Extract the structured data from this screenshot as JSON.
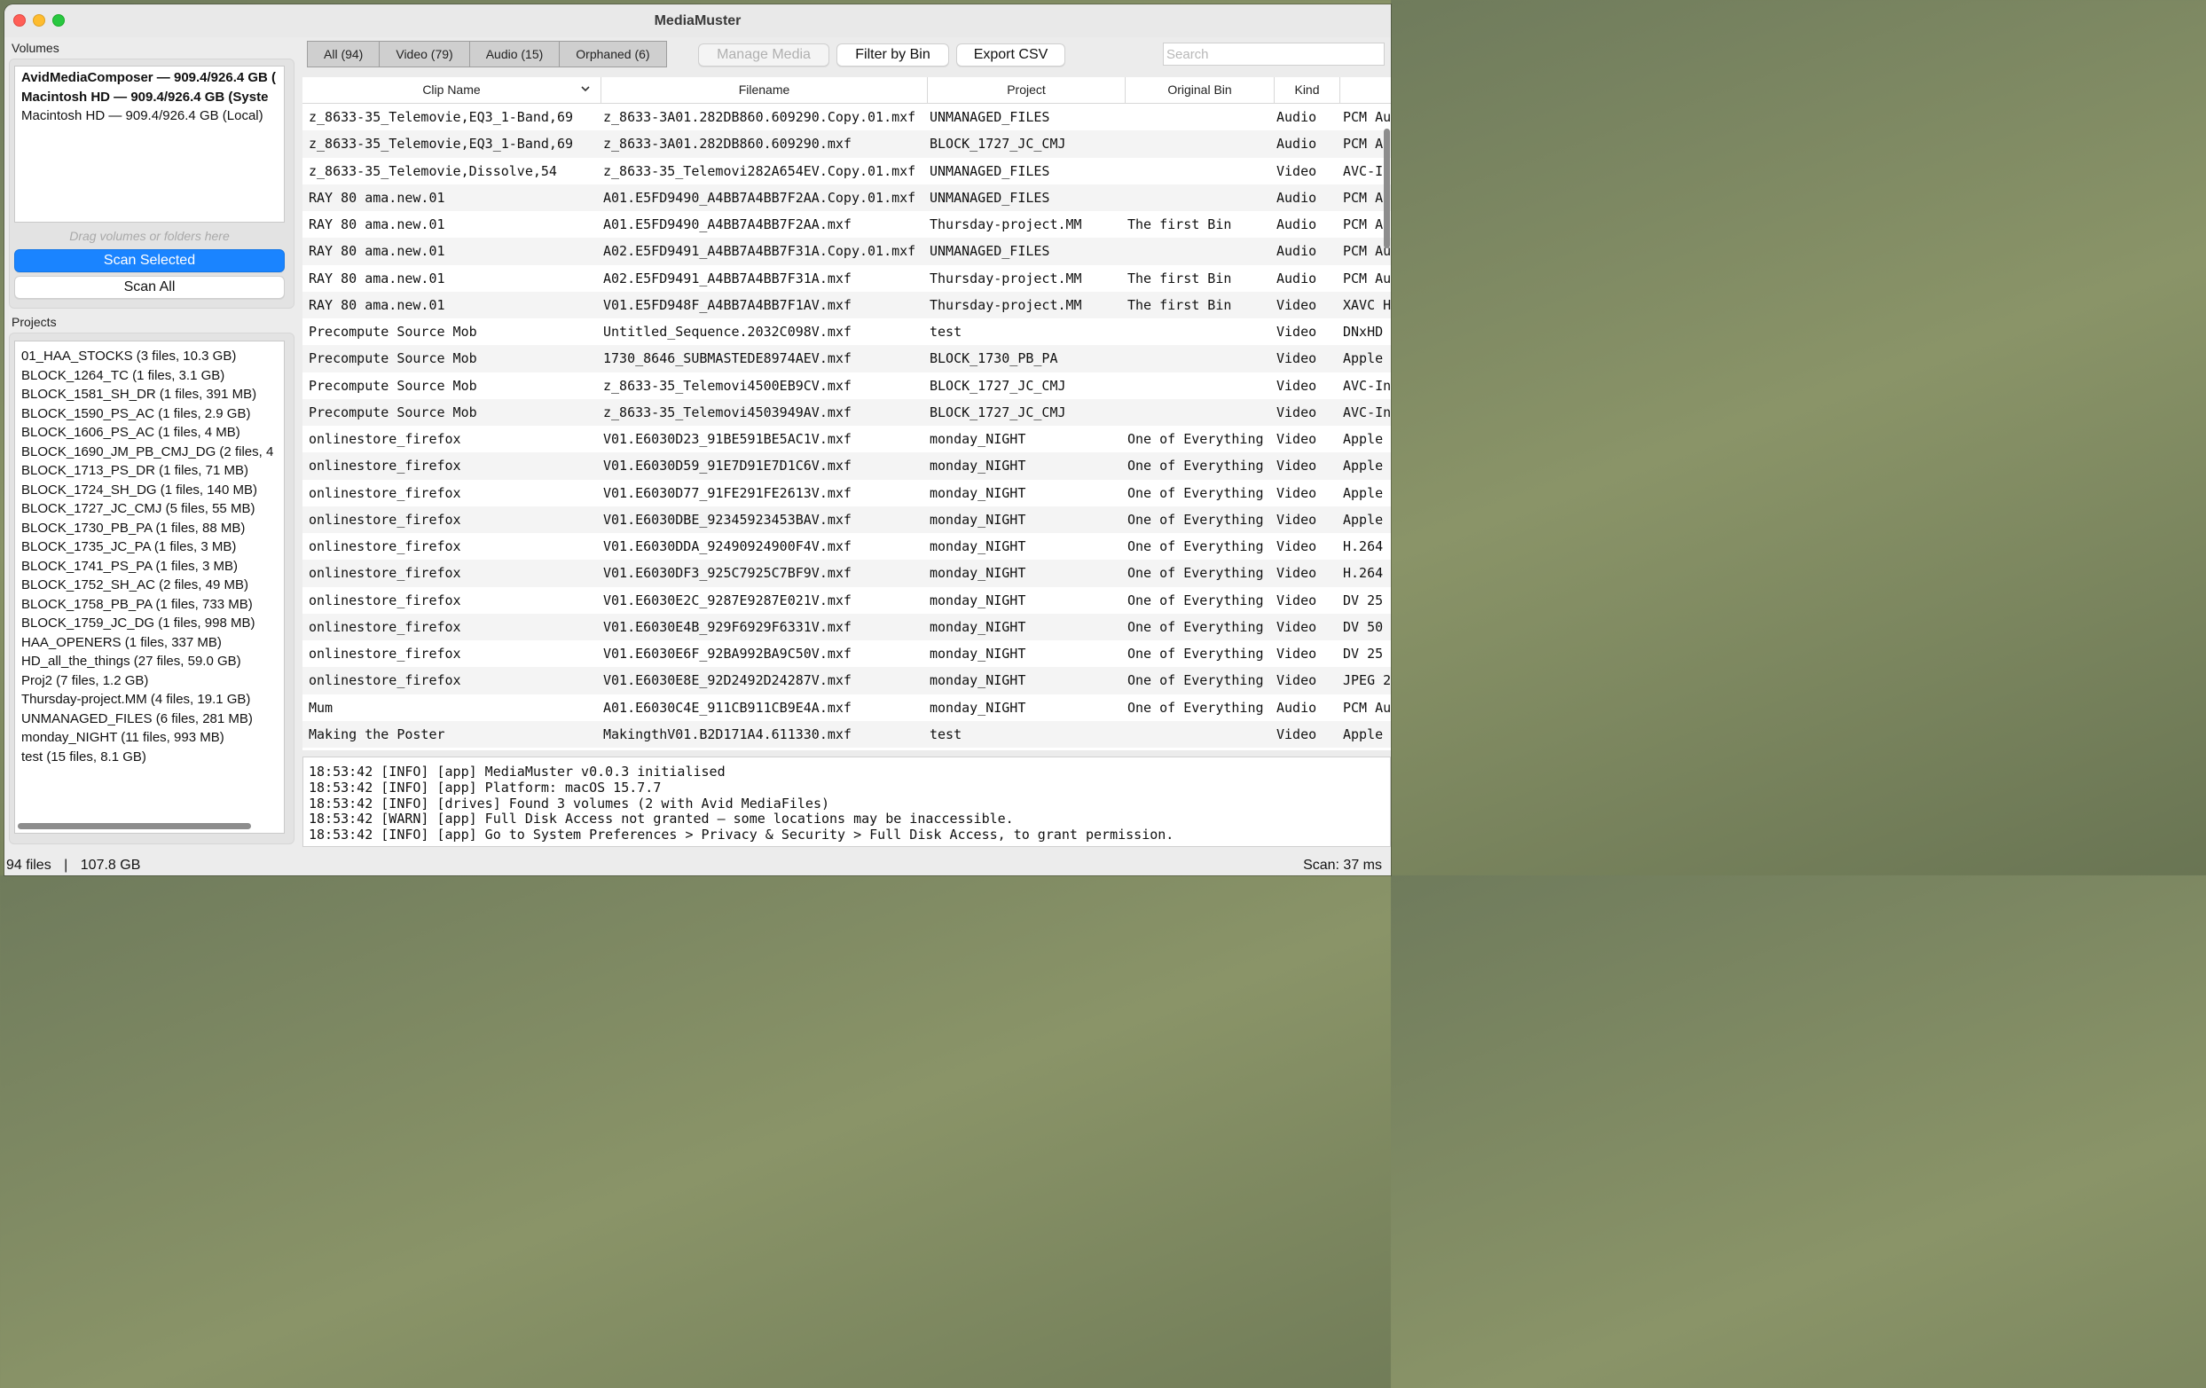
{
  "window": {
    "title": "MediaMuster"
  },
  "volumes": {
    "label": "Volumes",
    "items": [
      {
        "text": "AvidMediaComposer — 909.4/926.4 GB (",
        "bold": true
      },
      {
        "text": "Macintosh HD — 909.4/926.4 GB (Syste",
        "bold": true
      },
      {
        "text": "Macintosh HD — 909.4/926.4 GB (Local)",
        "bold": false
      }
    ],
    "drop_hint": "Drag volumes or folders here",
    "scan_selected": "Scan Selected",
    "scan_all": "Scan All"
  },
  "projects": {
    "label": "Projects",
    "items": [
      "01_HAA_STOCKS (3 files, 10.3 GB)",
      "BLOCK_1264_TC (1 files, 3.1 GB)",
      "BLOCK_1581_SH_DR (1 files, 391 MB)",
      "BLOCK_1590_PS_AC (1 files, 2.9 GB)",
      "BLOCK_1606_PS_AC (1 files, 4 MB)",
      "BLOCK_1690_JM_PB_CMJ_DG (2 files, 4",
      "BLOCK_1713_PS_DR (1 files, 71 MB)",
      "BLOCK_1724_SH_DG (1 files, 140 MB)",
      "BLOCK_1727_JC_CMJ (5 files, 55 MB)",
      "BLOCK_1730_PB_PA (1 files, 88 MB)",
      "BLOCK_1735_JC_PA (1 files, 3 MB)",
      "BLOCK_1741_PS_PA (1 files, 3 MB)",
      "BLOCK_1752_SH_AC (2 files, 49 MB)",
      "BLOCK_1758_PB_PA (1 files, 733 MB)",
      "BLOCK_1759_JC_DG (1 files, 998 MB)",
      "HAA_OPENERS (1 files, 337 MB)",
      "HD_all_the_things (27 files, 59.0 GB)",
      "Proj2 (7 files, 1.2 GB)",
      "Thursday-project.MM (4 files, 19.1 GB)",
      "UNMANAGED_FILES (6 files, 281 MB)",
      "monday_NIGHT (11 files, 993 MB)",
      "test (15 files, 8.1 GB)"
    ]
  },
  "toolbar": {
    "tabs": [
      "All (94)",
      "Video (79)",
      "Audio (15)",
      "Orphaned (6)"
    ],
    "manage_media": "Manage Media",
    "filter_by_bin": "Filter by Bin",
    "export_csv": "Export CSV",
    "search_placeholder": "Search"
  },
  "table": {
    "columns": [
      "Clip Name",
      "Filename",
      "Project",
      "Original Bin",
      "Kind",
      ""
    ],
    "rows": [
      [
        "z_8633-35_Telemovie,EQ3_1-Band,69",
        "z_8633-3A01.282DB860.609290.Copy.01.mxf",
        "UNMANAGED_FILES",
        "",
        "Audio",
        "PCM Au"
      ],
      [
        "z_8633-35_Telemovie,EQ3_1-Band,69",
        "z_8633-3A01.282DB860.609290.mxf",
        "BLOCK_1727_JC_CMJ",
        "",
        "Audio",
        "PCM Au"
      ],
      [
        "z_8633-35_Telemovie,Dissolve,54",
        "z_8633-35_Telemovi282A654EV.Copy.01.mxf",
        "UNMANAGED_FILES",
        "",
        "Video",
        "AVC-In"
      ],
      [
        "RAY 80 ama.new.01",
        "A01.E5FD9490_A4BB7A4BB7F2AA.Copy.01.mxf",
        "UNMANAGED_FILES",
        "",
        "Audio",
        "PCM Au"
      ],
      [
        "RAY 80 ama.new.01",
        "A01.E5FD9490_A4BB7A4BB7F2AA.mxf",
        "Thursday-project.MM",
        "The first Bin",
        "Audio",
        "PCM Au"
      ],
      [
        "RAY 80 ama.new.01",
        "A02.E5FD9491_A4BB7A4BB7F31A.Copy.01.mxf",
        "UNMANAGED_FILES",
        "",
        "Audio",
        "PCM Au"
      ],
      [
        "RAY 80 ama.new.01",
        "A02.E5FD9491_A4BB7A4BB7F31A.mxf",
        "Thursday-project.MM",
        "The first Bin",
        "Audio",
        "PCM Au"
      ],
      [
        "RAY 80 ama.new.01",
        "V01.E5FD948F_A4BB7A4BB7F1AV.mxf",
        "Thursday-project.MM",
        "The first Bin",
        "Video",
        "XAVC H"
      ],
      [
        "Precompute Source Mob",
        "Untitled_Sequence.2032C098V.mxf",
        "test",
        "",
        "Video",
        "DNxHD"
      ],
      [
        "Precompute Source Mob",
        "1730_8646_SUBMASTEDE8974AEV.mxf",
        "BLOCK_1730_PB_PA",
        "",
        "Video",
        "Apple"
      ],
      [
        "Precompute Source Mob",
        "z_8633-35_Telemovi4500EB9CV.mxf",
        "BLOCK_1727_JC_CMJ",
        "",
        "Video",
        "AVC-In"
      ],
      [
        "Precompute Source Mob",
        "z_8633-35_Telemovi4503949AV.mxf",
        "BLOCK_1727_JC_CMJ",
        "",
        "Video",
        "AVC-In"
      ],
      [
        "onlinestore_firefox",
        "V01.E6030D23_91BE591BE5AC1V.mxf",
        "monday_NIGHT",
        "One of Everything",
        "Video",
        "Apple"
      ],
      [
        "onlinestore_firefox",
        "V01.E6030D59_91E7D91E7D1C6V.mxf",
        "monday_NIGHT",
        "One of Everything",
        "Video",
        "Apple"
      ],
      [
        "onlinestore_firefox",
        "V01.E6030D77_91FE291FE2613V.mxf",
        "monday_NIGHT",
        "One of Everything",
        "Video",
        "Apple"
      ],
      [
        "onlinestore_firefox",
        "V01.E6030DBE_92345923453BAV.mxf",
        "monday_NIGHT",
        "One of Everything",
        "Video",
        "Apple"
      ],
      [
        "onlinestore_firefox",
        "V01.E6030DDA_92490924900F4V.mxf",
        "monday_NIGHT",
        "One of Everything",
        "Video",
        "H.264"
      ],
      [
        "onlinestore_firefox",
        "V01.E6030DF3_925C7925C7BF9V.mxf",
        "monday_NIGHT",
        "One of Everything",
        "Video",
        "H.264"
      ],
      [
        "onlinestore_firefox",
        "V01.E6030E2C_9287E9287E021V.mxf",
        "monday_NIGHT",
        "One of Everything",
        "Video",
        "DV 25"
      ],
      [
        "onlinestore_firefox",
        "V01.E6030E4B_929F6929F6331V.mxf",
        "monday_NIGHT",
        "One of Everything",
        "Video",
        "DV 50"
      ],
      [
        "onlinestore_firefox",
        "V01.E6030E6F_92BA992BA9C50V.mxf",
        "monday_NIGHT",
        "One of Everything",
        "Video",
        "DV 25"
      ],
      [
        "onlinestore_firefox",
        "V01.E6030E8E_92D2492D24287V.mxf",
        "monday_NIGHT",
        "One of Everything",
        "Video",
        "JPEG 2"
      ],
      [
        "Mum",
        "A01.E6030C4E_911CB911CB9E4A.mxf",
        "monday_NIGHT",
        "One of Everything",
        "Audio",
        "PCM Au"
      ],
      [
        "Making the Poster",
        "MakingthV01.B2D171A4.611330.mxf",
        "test",
        "",
        "Video",
        "Apple"
      ]
    ]
  },
  "log": [
    "18:53:42 [INFO] [app] MediaMuster v0.0.3 initialised",
    "18:53:42 [INFO] [app] Platform: macOS 15.7.7",
    "18:53:42 [INFO] [drives] Found 3 volumes (2 with Avid MediaFiles)",
    "18:53:42 [WARN] [app] Full Disk Access not granted — some locations may be inaccessible.",
    "18:53:42 [INFO] [app] Go to System Preferences > Privacy & Security > Full Disk Access, to grant permission."
  ],
  "status": {
    "files": "94 files",
    "separator": "|",
    "size": "107.8 GB",
    "scan": "Scan: 37 ms"
  }
}
